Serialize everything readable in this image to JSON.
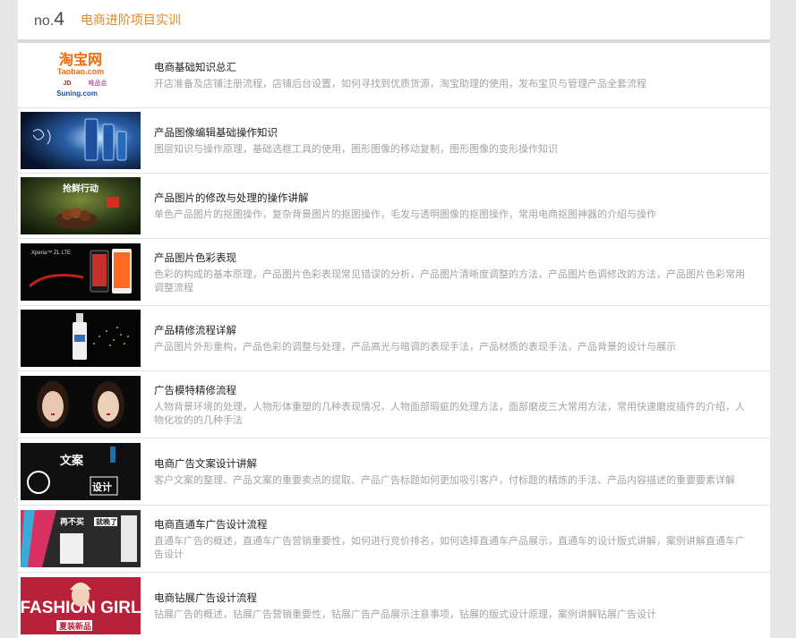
{
  "header": {
    "prefix": "no.",
    "number": "4",
    "title": "电商进阶项目实训"
  },
  "logos": {
    "taobao_cn": "淘宝网",
    "taobao_en": "Taobao.com",
    "jd": "JD",
    "vip": "唯品会",
    "suning": "Suning.com"
  },
  "courses": [
    {
      "title": "电商基础知识总汇",
      "desc": "开店准备及店铺注册流程，店铺后台设置，如何寻找到优质货源，淘宝助理的使用，发布宝贝与管理产品全套流程"
    },
    {
      "title": "产品图像编辑基础操作知识",
      "desc": "图层知识与操作原理，基础选框工具的使用，图形图像的移动复制，图形图像的变形操作知识"
    },
    {
      "title": "产品图片的修改与处理的操作讲解",
      "desc": "单色产品图片的抠图操作，复杂背景图片的抠图操作，毛发与透明图像的抠图操作，常用电商抠图神器的介绍与操作"
    },
    {
      "title": "产品图片色彩表现",
      "desc": "色彩的构成的基本原理，产品图片色彩表现常见错误的分析，产品图片清晰度调整的方法，产品图片色调修改的方法，产品图片色彩常用调整流程"
    },
    {
      "title": "产品精修流程详解",
      "desc": "产品图片外形重构，产品色彩的调整与处理，产品高光与暗调的表现手法，产品材质的表现手法，产品背景的设计与展示"
    },
    {
      "title": "广告模特精修流程",
      "desc": "人物背景环境的处理，人物形体重塑的几种表现情况，人物面部瑕疵的处理方法，面部磨皮三大常用方法，常用快速磨皮插件的介绍，人物化妆的的几种手法"
    },
    {
      "title": "电商广告文案设计讲解",
      "desc": "客户文案的整理、产品文案的重要卖点的提取、产品广告标题如何更加吸引客户，付标题的精炼的手法、产品内容描述的重要要素详解"
    },
    {
      "title": "电商直通车广告设计流程",
      "desc": "直通车广告的概述，直通车广告营销重要性，如何进行竞价排名，如何选择直通车产品展示，直通车的设计版式讲解，案例讲解直通车广告设计"
    },
    {
      "title": "电商钻展广告设计流程",
      "desc": "钻展广告的概述，钻展广告营销重要性，钻展广告产品展示注意事项，钻展的版式设计原理，案例讲解钻展广告设计"
    }
  ],
  "thumb_texts": {
    "t3": "抢鲜行动",
    "t4": "Xperia™ ZL LTE",
    "t7a": "文案",
    "t7b": "设计",
    "t8a": "再不买",
    "t8b": "就晚了",
    "t9a": "FASHION GIRL",
    "t9b": "夏装新品"
  }
}
